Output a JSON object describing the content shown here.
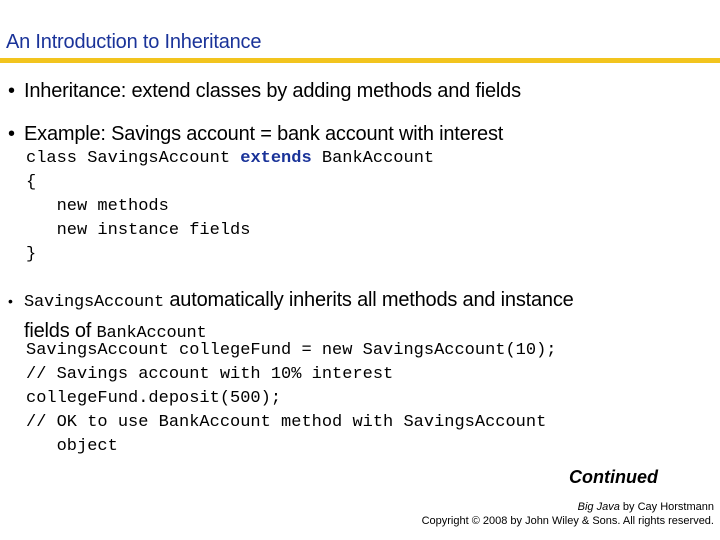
{
  "slide": {
    "title": "An Introduction to Inheritance",
    "accent_color": "#f2c41e",
    "title_color": "#1a3399"
  },
  "bullets": [
    {
      "text": "Inheritance: extend classes by adding methods and fields"
    },
    {
      "text": "Example: Savings account = bank account with interest"
    },
    {
      "code_prefix": "SavingsAccount",
      "text": " automatically inherits all methods and instance",
      "line2_text": "fields of ",
      "line2_code": "BankAccount"
    }
  ],
  "code_block_1": {
    "line1_a": "class SavingsAccount ",
    "line1_kw": "extends",
    "line1_b": " BankAccount",
    "line2": "{",
    "line3": "   new methods",
    "line4": "   new instance fields",
    "line5": "}"
  },
  "code_block_2": {
    "lines": [
      "SavingsAccount collegeFund = new SavingsAccount(10);",
      "// Savings account with 10% interest",
      "collegeFund.deposit(500);",
      "// OK to use BankAccount method with SavingsAccount",
      "   object"
    ]
  },
  "footer": {
    "continued": "Continued",
    "book_title": "Big Java",
    "book_author": " by Cay Horstmann",
    "copyright": "Copyright © 2008 by John Wiley & Sons.  All rights reserved."
  }
}
